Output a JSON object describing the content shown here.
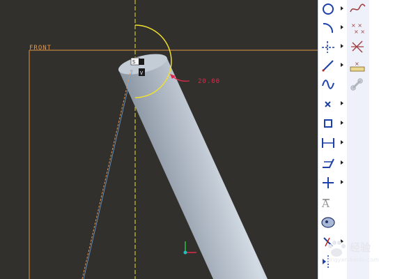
{
  "viewport": {
    "reference_plane": "FRONT",
    "dimension_value": "20.00",
    "background_color": "#32302c",
    "sketch_color": "#f0e030",
    "reference_color": "#e2964a",
    "dimension_color": "#e0284a",
    "tube_color": "#b6c0cc"
  },
  "toolbar": {
    "tools": [
      {
        "name": "circle-tool",
        "icon": "circle-icon"
      },
      {
        "name": "arc-tool",
        "icon": "arc-icon"
      },
      {
        "name": "centerline-tool",
        "icon": "centerline-icon"
      },
      {
        "name": "line-tool",
        "icon": "line-icon"
      },
      {
        "name": "spline-tool",
        "icon": "spline-icon"
      },
      {
        "name": "point-tool",
        "icon": "point-icon"
      },
      {
        "name": "offset-tool",
        "icon": "offset-icon"
      },
      {
        "name": "dimension-tool",
        "icon": "dimension-icon"
      },
      {
        "name": "modify-tool",
        "icon": "modify-icon"
      },
      {
        "name": "constraint-tool",
        "icon": "constraint-icon"
      },
      {
        "name": "text-tool",
        "icon": "text-icon"
      },
      {
        "name": "palette-tool",
        "icon": "palette-icon"
      },
      {
        "name": "trim-tool",
        "icon": "trim-icon"
      },
      {
        "name": "mirror-tool",
        "icon": "mirror-icon"
      }
    ],
    "secondary_tools": [
      {
        "name": "curve-tool",
        "icon": "curve-icon"
      },
      {
        "name": "point-cloud-tool",
        "icon": "point-cloud-icon"
      },
      {
        "name": "coord-sys-tool",
        "icon": "coordinate-system-icon"
      },
      {
        "name": "ruler-tool",
        "icon": "ruler-icon"
      },
      {
        "name": "link-tool",
        "icon": "link-icon"
      }
    ]
  },
  "watermark": {
    "title": "经验",
    "url": "jingyan.baidu.com"
  }
}
